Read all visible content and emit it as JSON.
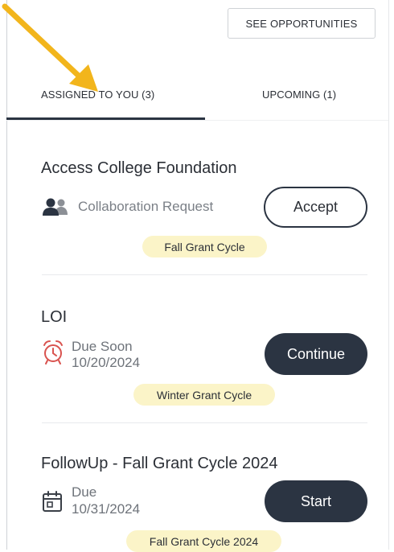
{
  "header": {
    "see_opportunities_label": "SEE OPPORTUNITIES"
  },
  "tabs": [
    {
      "label": "ASSIGNED TO YOU (3)",
      "active": true
    },
    {
      "label": "UPCOMING (1)",
      "active": false
    }
  ],
  "tasks": [
    {
      "title": "Access College Foundation",
      "status_icon": "users-icon",
      "status_text": "Collaboration Request",
      "action_label": "Accept",
      "cycle": "Fall Grant Cycle"
    },
    {
      "title": "LOI",
      "status_icon": "alarm-clock-icon",
      "status_text": "Due Soon",
      "date": "10/20/2024",
      "action_label": "Continue",
      "cycle": "Winter Grant Cycle"
    },
    {
      "title": "FollowUp - Fall Grant Cycle 2024",
      "status_icon": "calendar-icon",
      "status_text": "Due",
      "date": "10/31/2024",
      "action_label": "Start",
      "cycle": "Fall Grant Cycle 2024"
    }
  ],
  "colors": {
    "primary": "#2b3442",
    "pill_bg": "#fbf4c8",
    "alarm_red": "#d9534f",
    "arrow_yellow": "#f2b51c"
  }
}
